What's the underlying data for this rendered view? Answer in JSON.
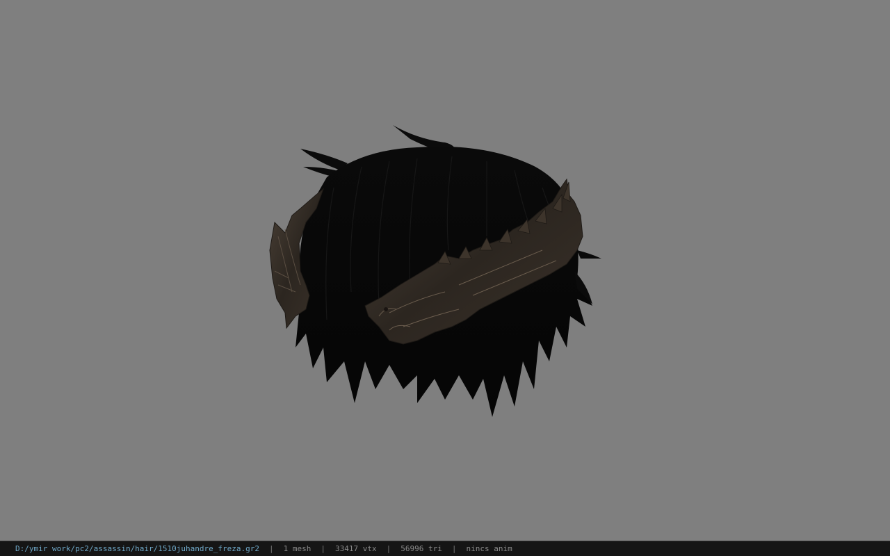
{
  "viewport": {
    "background": "#7f7f7f",
    "model_name": "hair-with-dragon-crown"
  },
  "status_bar": {
    "file_path": "D:/ymir work/pc2/assassin/hair/1510juhandre_freza.gr2",
    "separator": "|",
    "mesh_count": "1 mesh",
    "vertex_count": "33417 vtx",
    "triangle_count": "56996 tri",
    "anim_status": "nincs anim",
    "path_color": "#6fa8c8",
    "text_color": "#8a8a8a"
  }
}
